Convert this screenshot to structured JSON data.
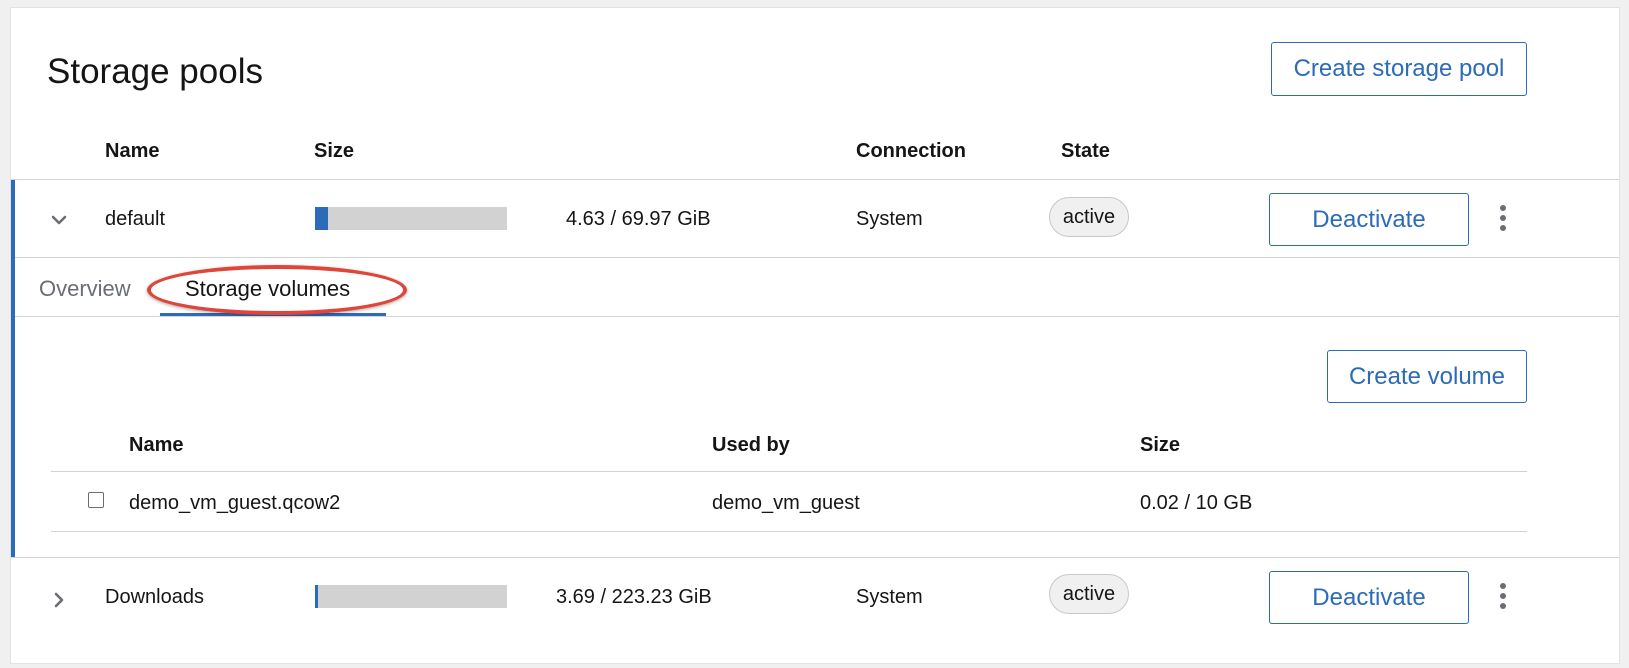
{
  "page": {
    "title": "Storage pools",
    "create_pool_label": "Create storage pool"
  },
  "pools_table": {
    "headers": {
      "name": "Name",
      "size": "Size",
      "connection": "Connection",
      "state": "State"
    },
    "rows": [
      {
        "name": "default",
        "size_text": "4.63 / 69.97 GiB",
        "usage_fraction": 0.066,
        "connection": "System",
        "state": "active",
        "action_label": "Deactivate",
        "expanded": true
      },
      {
        "name": "Downloads",
        "size_text": "3.69 / 223.23 GiB",
        "usage_fraction": 0.017,
        "connection": "System",
        "state": "active",
        "action_label": "Deactivate",
        "expanded": false
      }
    ]
  },
  "expanded_detail": {
    "tabs": [
      "Overview",
      "Storage volumes"
    ],
    "active_tab": "Storage volumes",
    "create_volume_label": "Create volume",
    "volumes_table": {
      "headers": {
        "name": "Name",
        "used_by": "Used by",
        "size": "Size"
      },
      "rows": [
        {
          "name": "demo_vm_guest.qcow2",
          "used_by": "demo_vm_guest",
          "size": "0.02 / 10 GB",
          "checked": false
        }
      ]
    }
  },
  "colors": {
    "accent": "#2b6bb8",
    "annotation_ring": "#e0453a",
    "bar_track": "#d2d2d2"
  },
  "icons": {
    "expanded_toggle": "chevron-down-icon",
    "collapsed_toggle": "chevron-right-icon",
    "row_menu": "kebab-menu-icon"
  }
}
